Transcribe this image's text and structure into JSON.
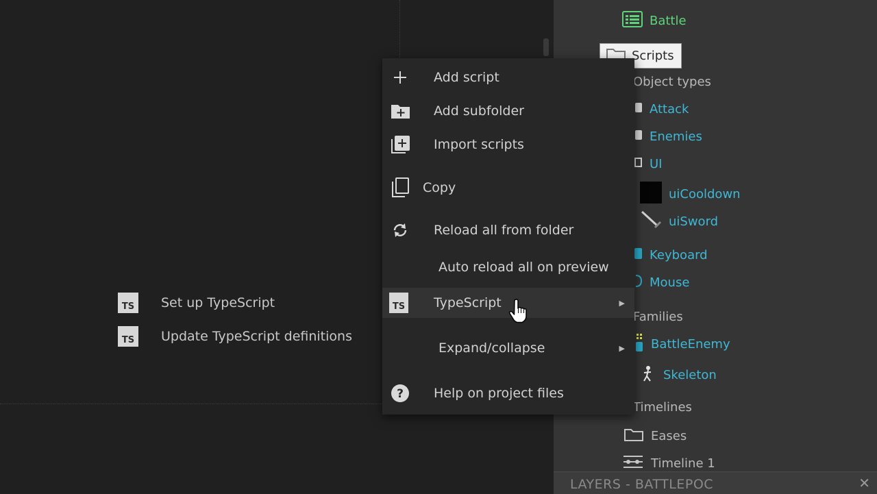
{
  "tree": {
    "items": [
      {
        "label": "Battle",
        "icon": "layout-grid-icon",
        "color": "#5fd37a"
      },
      {
        "label": "Scripts",
        "icon": "folder-icon",
        "selected": true
      },
      {
        "label": "Object types",
        "icon": "folder-icon"
      },
      {
        "label": "Attack",
        "icon": "object-icon",
        "color": "#3fb8d6"
      },
      {
        "label": "Enemies",
        "icon": "object-icon",
        "color": "#3fb8d6"
      },
      {
        "label": "UI",
        "icon": "folder-icon",
        "color": "#3fb8d6"
      },
      {
        "label": "uiCooldown",
        "icon": "black-square-icon",
        "color": "#3fb8d6"
      },
      {
        "label": "uiSword",
        "icon": "sword-icon",
        "color": "#3fb8d6"
      },
      {
        "label": "Keyboard",
        "icon": "keyboard-icon",
        "color": "#3fb8d6"
      },
      {
        "label": "Mouse",
        "icon": "mouse-icon",
        "color": "#3fb8d6"
      },
      {
        "label": "Families",
        "icon": "folder-icon"
      },
      {
        "label": "BattleEnemy",
        "icon": "family-icon",
        "color": "#3fb8d6"
      },
      {
        "label": "Skeleton",
        "icon": "skeleton-icon",
        "color": "#3fb8d6"
      },
      {
        "label": "Timelines",
        "icon": "folder-icon"
      },
      {
        "label": "Eases",
        "icon": "folder-icon"
      },
      {
        "label": "Timeline 1",
        "icon": "timeline-icon"
      }
    ]
  },
  "layers": {
    "title": "LAYERS - BATTLEPOC",
    "close": "✕"
  },
  "menu": {
    "items": [
      {
        "label": "Add script",
        "icon": "plus-icon"
      },
      {
        "label": "Add subfolder",
        "icon": "add-folder-icon"
      },
      {
        "label": "Import scripts",
        "icon": "import-icon"
      },
      {
        "label": "Copy",
        "icon": "copy-icon"
      },
      {
        "label": "Reload all from folder",
        "icon": "reload-icon"
      },
      {
        "label": "Auto reload all on preview",
        "icon": ""
      },
      {
        "label": "TypeScript",
        "icon": "ts-icon",
        "submenu": true
      },
      {
        "label": "Expand/collapse",
        "icon": "",
        "submenu": true
      },
      {
        "label": "Help on project files",
        "icon": "help-icon"
      }
    ],
    "ts_icon_text": "TS",
    "submenu_arrow": "▶"
  },
  "submenu": {
    "items": [
      {
        "label": "Set up TypeScript",
        "icon": "ts-icon"
      },
      {
        "label": "Update TypeScript definitions",
        "icon": "ts-icon"
      }
    ]
  }
}
